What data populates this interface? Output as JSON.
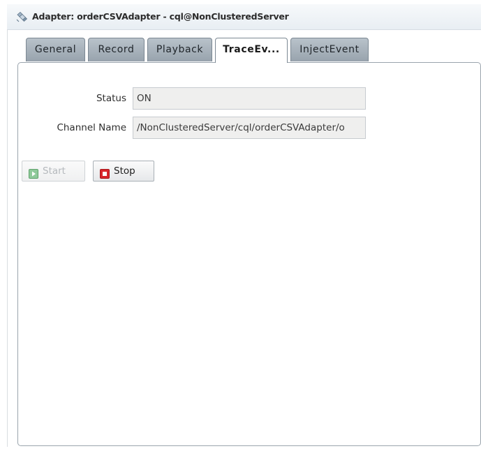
{
  "window": {
    "title": "Adapter: orderCSVAdapter - cql@NonClusteredServer",
    "icon": "adapter-icon"
  },
  "tabs": [
    {
      "label": "General",
      "active": false
    },
    {
      "label": "Record",
      "active": false
    },
    {
      "label": "Playback",
      "active": false
    },
    {
      "label": "TraceEv...",
      "active": true
    },
    {
      "label": "InjectEvent",
      "active": false
    }
  ],
  "trace_event": {
    "status": {
      "label": "Status",
      "value": "ON"
    },
    "channel_name": {
      "label": "Channel Name",
      "value": "/NonClusteredServer/cql/orderCSVAdapter/o"
    },
    "buttons": {
      "start": {
        "label": "Start",
        "icon": "play-icon",
        "enabled": false
      },
      "stop": {
        "label": "Stop",
        "icon": "stop-icon",
        "enabled": true
      }
    }
  },
  "colors": {
    "tab_inactive": "#a8b1ba",
    "start_icon": "#3aa34a",
    "stop_icon": "#d8262b",
    "field_background": "#efefee"
  }
}
